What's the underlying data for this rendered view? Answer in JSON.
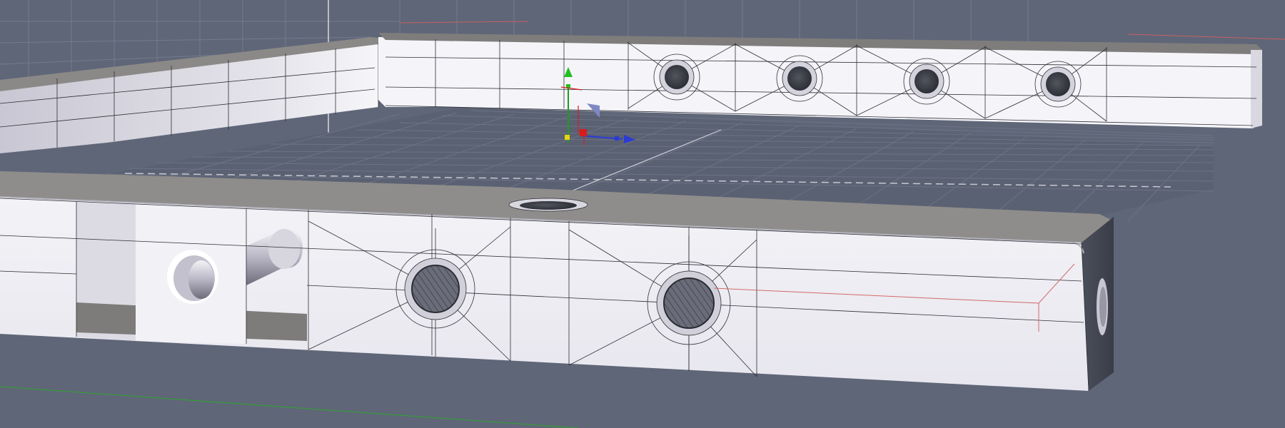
{
  "viewport": {
    "background_color": "#5f6678",
    "grid_color": "#737b8d",
    "part_face_color": "#eeeef4",
    "part_top_color": "#8e8c8a",
    "wire_color": "#2c2c34"
  },
  "gizmo": {
    "x_axis_color": "#2b3bd6",
    "y_axis_color": "#22b822",
    "z_axis_color": "#d81c1c",
    "origin_color": "#e6d60b",
    "icons": [
      "move-gizmo-icon"
    ]
  },
  "scene": {
    "elements": [
      "frame-back-rail",
      "frame-left-rail",
      "frame-front-rail",
      "frame-floor-grid",
      "countersunk-holes",
      "dowel-pin"
    ]
  }
}
